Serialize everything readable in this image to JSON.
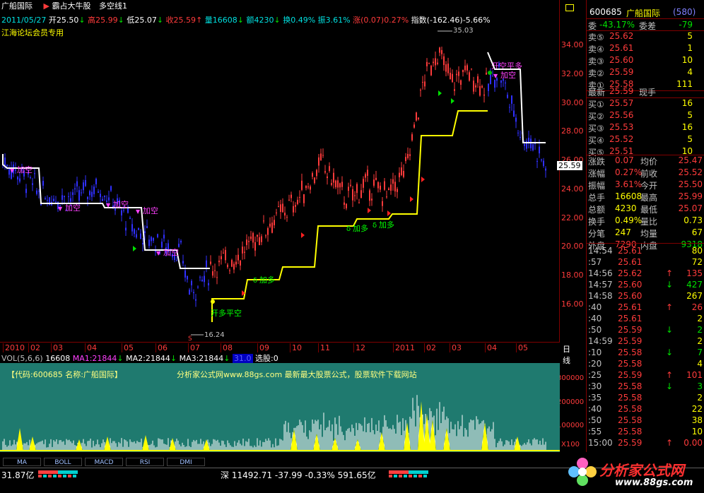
{
  "header": {
    "stock_name": "广船国际",
    "flag_label": "霸占大牛股",
    "indicator_name": "多空线1",
    "date": "2011/05/27",
    "open_label": "开25.50",
    "high_label": "高25.99",
    "low_label": "低25.07",
    "close_label": "收25.59",
    "volume_label": "量16608",
    "amount_label": "额4230",
    "turnover_label": "换0.49%",
    "amplitude_label": "振3.61%",
    "change_label": "涨(0.07)0.27%",
    "index_label": "指数(-162.46)-5.66%",
    "note": "江海论坛会员专用"
  },
  "chart_annotations": {
    "high_value": "35.03",
    "low_value": "16.24",
    "add_short_labels": [
      "加空",
      "加空",
      "加空",
      "加空",
      "加空"
    ],
    "close_short_open_long": "开空平多",
    "open_long_close_short": "开多平空",
    "add_long_labels": [
      "加多",
      "加多",
      "加多"
    ],
    "last_price_tag": "25.59",
    "low_marker": "S"
  },
  "y_axis": {
    "ticks": [
      "34.00",
      "32.00",
      "30.00",
      "28.00",
      "26.00",
      "24.00",
      "22.00",
      "20.00",
      "18.00",
      "16.00"
    ],
    "vol_ticks": [
      "300000",
      "200000",
      "100000"
    ],
    "vol_unit": "X100"
  },
  "x_axis": {
    "labels": [
      "2010",
      "02",
      "03",
      "04",
      "05",
      "06",
      "07",
      "08",
      "09",
      "10",
      "11",
      "12",
      "2011",
      "02",
      "03",
      "04",
      "05"
    ],
    "period": "日线"
  },
  "volume_info": {
    "name": "VOL(5,6,6)",
    "value": "16608",
    "ma1": "MA1:21844",
    "ma2": "MA2:21844",
    "ma3": "MA3:21844",
    "extra": "31.0",
    "select": "选股:0",
    "code_text": "【代码:600685 名称:广船国际】",
    "promo_text": "分析家公式网www.88gs.com 最新最大股票公式，股票软件下载网站"
  },
  "tabs": [
    "MA",
    "BOLL",
    "MACD",
    "RSI",
    "DMI"
  ],
  "status_bar": {
    "left_amount": "31.87亿",
    "index_text": "深 11492.71 -37.99 -0.33% 591.65亿",
    "logo_text": "分析家公式网",
    "logo_url": "www.88gs.com"
  },
  "quote_panel": {
    "code": "600685",
    "name": "广船国际",
    "code2": "(580)",
    "ratio_label": "委",
    "ratio_value": "-43.17%",
    "diff_label": "委差",
    "diff_value": "-79",
    "sells": [
      {
        "label": "卖⑤",
        "price": "25.62",
        "vol": "5"
      },
      {
        "label": "卖④",
        "price": "25.61",
        "vol": "1"
      },
      {
        "label": "卖③",
        "price": "25.60",
        "vol": "10"
      },
      {
        "label": "卖②",
        "price": "25.59",
        "vol": "4"
      },
      {
        "label": "卖①",
        "price": "25.58",
        "vol": "111"
      }
    ],
    "latest_label": "最新",
    "latest_price": "25.59",
    "latest_vol_label": "现手",
    "buys": [
      {
        "label": "买①",
        "price": "25.57",
        "vol": "16"
      },
      {
        "label": "买②",
        "price": "25.56",
        "vol": "5"
      },
      {
        "label": "买③",
        "price": "25.53",
        "vol": "16"
      },
      {
        "label": "买④",
        "price": "25.52",
        "vol": "5"
      },
      {
        "label": "买⑤",
        "price": "25.51",
        "vol": "10"
      }
    ],
    "stats": [
      {
        "l1": "涨跌",
        "v1": "0.07",
        "l2": "均价",
        "v2": "25.47"
      },
      {
        "l1": "涨幅",
        "v1": "0.27%",
        "l2": "前收",
        "v2": "25.52"
      },
      {
        "l1": "振幅",
        "v1": "3.61%",
        "l2": "今开",
        "v2": "25.50"
      },
      {
        "l1": "总手",
        "v1": "16608",
        "l2": "最高",
        "v2": "25.99"
      },
      {
        "l1": "总额",
        "v1": "4230",
        "l2": "最低",
        "v2": "25.07"
      },
      {
        "l1": "换手",
        "v1": "0.49%",
        "l2": "量比",
        "v2": "0.73"
      },
      {
        "l1": "分笔",
        "v1": "247",
        "l2": "均量",
        "v2": "67"
      },
      {
        "l1": "外盘",
        "v1": "7290",
        "l2": "内盘",
        "v2": "9318"
      }
    ],
    "ticks": [
      {
        "time": "14:54",
        "price": "25.61",
        "vol": "80",
        "dir": ""
      },
      {
        "time": ":57",
        "price": "25.61",
        "vol": "72",
        "dir": ""
      },
      {
        "time": "14:56",
        "price": "25.62",
        "vol": "135",
        "dir": "↑"
      },
      {
        "time": "14:57",
        "price": "25.60",
        "vol": "427",
        "dir": "↓"
      },
      {
        "time": "14:58",
        "price": "25.60",
        "vol": "267",
        "dir": ""
      },
      {
        "time": ":40",
        "price": "25.61",
        "vol": "26",
        "dir": "↑"
      },
      {
        "time": ":40",
        "price": "25.61",
        "vol": "2",
        "dir": ""
      },
      {
        "time": ":50",
        "price": "25.59",
        "vol": "2",
        "dir": "↓"
      },
      {
        "time": "14:59",
        "price": "25.59",
        "vol": "2",
        "dir": ""
      },
      {
        "time": ":10",
        "price": "25.58",
        "vol": "7",
        "dir": "↓"
      },
      {
        "time": ":20",
        "price": "25.58",
        "vol": "4",
        "dir": ""
      },
      {
        "time": ":25",
        "price": "25.59",
        "vol": "101",
        "dir": "↑"
      },
      {
        "time": ":30",
        "price": "25.58",
        "vol": "3",
        "dir": "↓"
      },
      {
        "time": ":35",
        "price": "25.58",
        "vol": "2",
        "dir": ""
      },
      {
        "time": ":40",
        "price": "25.58",
        "vol": "22",
        "dir": ""
      },
      {
        "time": ":50",
        "price": "25.58",
        "vol": "38",
        "dir": ""
      },
      {
        "time": ":55",
        "price": "25.58",
        "vol": "10",
        "dir": ""
      },
      {
        "time": "15:00",
        "price": "25.59",
        "vol": "0.00",
        "dir": "↑"
      }
    ]
  },
  "colors": {
    "up": "#ff3b3b",
    "down": "#3030ff",
    "upper_line": "#ffffff",
    "lower_line": "#ffff00",
    "vol_bg": "#1f7a6f"
  }
}
